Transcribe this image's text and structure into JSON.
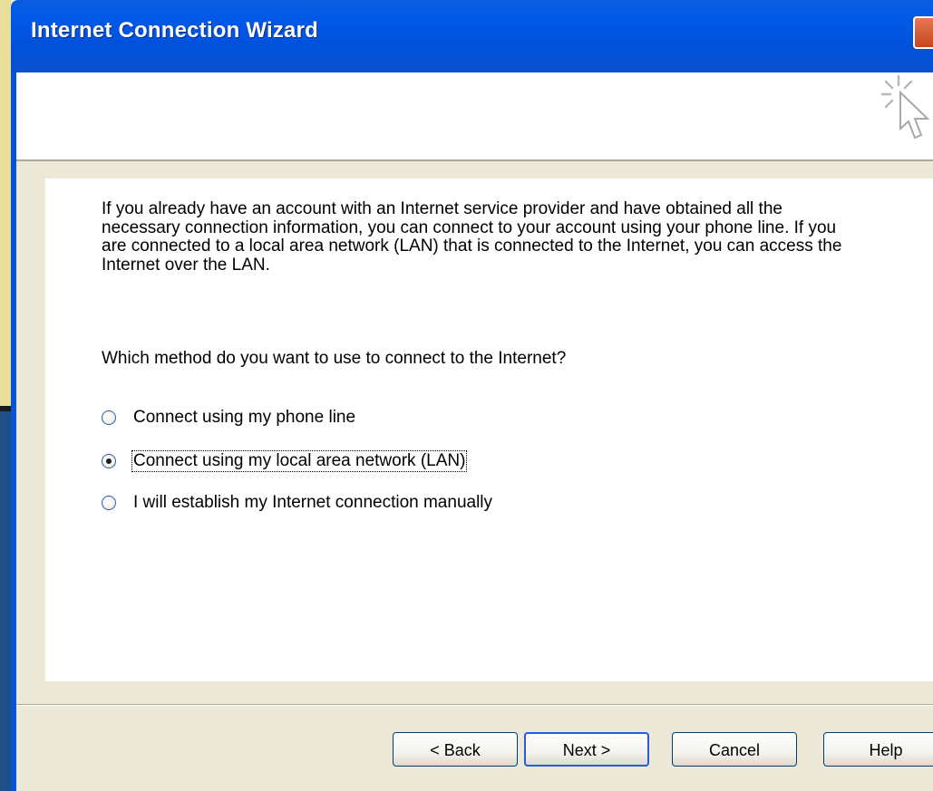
{
  "window": {
    "title": "Internet Connection Wizard"
  },
  "content": {
    "intro": "If you already have an account with an Internet service provider and have obtained all the necessary connection information, you can connect to your account using your phone line. If you are connected to a local area network (LAN) that is connected to the Internet, you can access the Internet over the LAN.",
    "question": "Which method do you want to use to connect to the Internet?",
    "options": [
      {
        "label": "Connect using my phone line",
        "selected": false
      },
      {
        "label": "Connect using my local area network (LAN)",
        "selected": true
      },
      {
        "label": "I will establish my Internet connection manually",
        "selected": false
      }
    ]
  },
  "buttons": {
    "back": "< Back",
    "next": "Next >",
    "cancel": "Cancel",
    "help": "Help"
  },
  "colors": {
    "titlebar": "#0058E6",
    "dialog_bg": "#ECE9D8",
    "content_bg": "#FFFFFF",
    "default_button_border": "#245DDB"
  },
  "icons": {
    "close": "close-icon",
    "wizard": "wizard-cursor-icon"
  }
}
